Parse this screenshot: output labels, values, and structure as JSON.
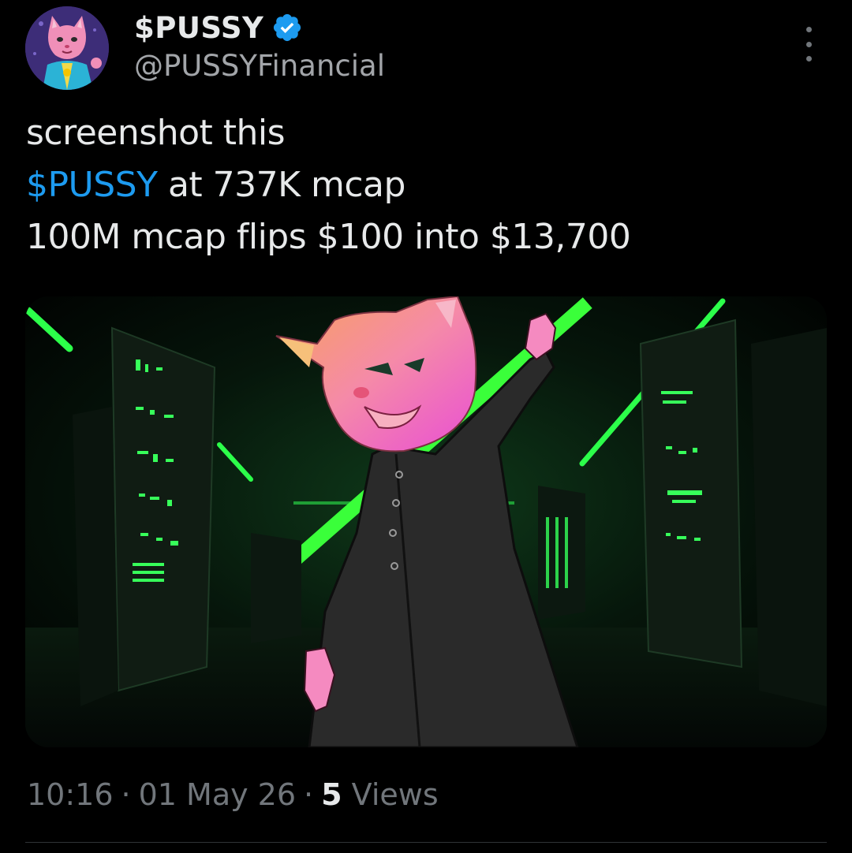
{
  "author": {
    "display_name": "$PUSSY",
    "handle": "@PUSSYFinancial",
    "verified": true,
    "verified_color": "#1d9bf0",
    "avatar_icon": "pink-cat-avatar"
  },
  "more_icon": "more-vertical-icon",
  "tweet": {
    "line1": "screenshot this",
    "cashtag": "$PUSSY",
    "line2_rest": " at 737K mcap",
    "line3": "100M mcap flips $100 into $13,700",
    "link_color": "#1d9bf0"
  },
  "media": {
    "description_icon": "pink-cat-in-black-coat-server-room-image"
  },
  "meta": {
    "time": "10:16",
    "separator": "·",
    "date": "01 May 26",
    "views_count": "5",
    "views_label": " Views"
  }
}
